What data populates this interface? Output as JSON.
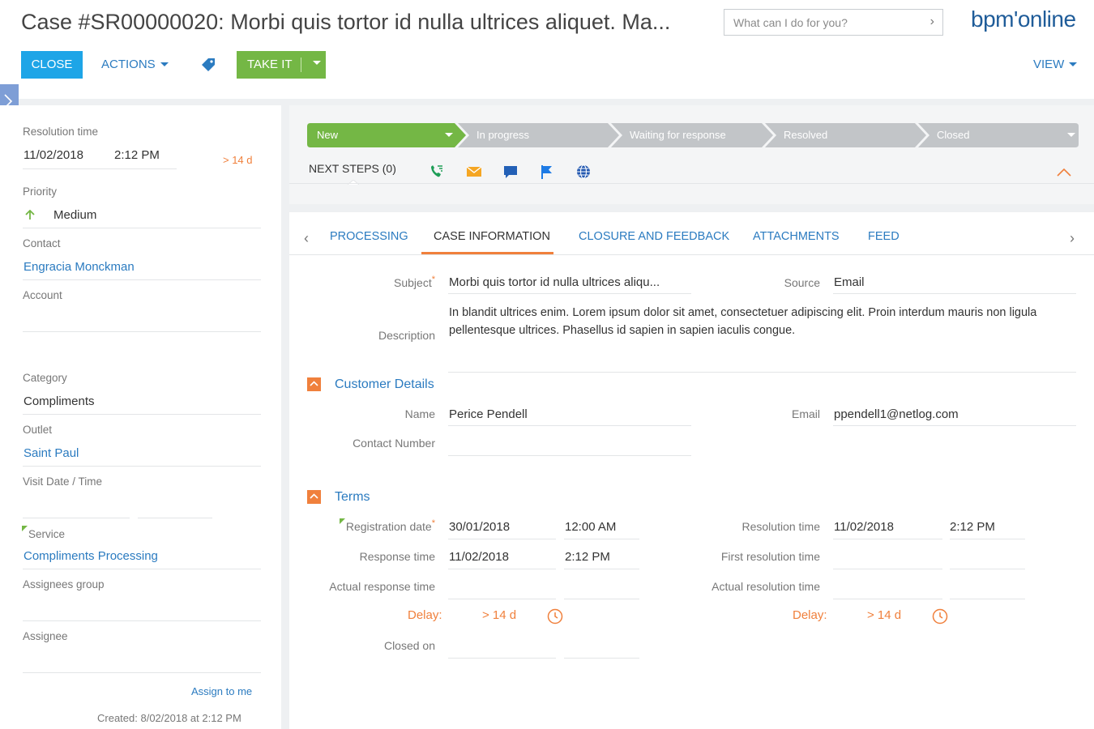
{
  "header": {
    "title": "Case #SR00000020: Morbi quis tortor id nulla ultrices aliquet. Ma...",
    "search_placeholder": "What can I do for you?",
    "brand": "bpm'online",
    "close_label": "CLOSE",
    "actions_label": "ACTIONS",
    "takeit_label": "TAKE IT",
    "view_label": "VIEW"
  },
  "left": {
    "resolution_time_label": "Resolution time",
    "resolution_date": "11/02/2018",
    "resolution_time": "2:12 PM",
    "resolution_overdue": "> 14 d",
    "priority_label": "Priority",
    "priority_value": "Medium",
    "contact_label": "Contact",
    "contact_value": "Engracia Monckman",
    "account_label": "Account",
    "category_label": "Category",
    "category_value": "Compliments",
    "outlet_label": "Outlet",
    "outlet_value": "Saint Paul",
    "visit_label": "Visit Date / Time",
    "service_label": "Service",
    "service_value": "Compliments Processing",
    "assignees_group_label": "Assignees group",
    "assignee_label": "Assignee",
    "assign_to_me": "Assign to me",
    "created": "Created: 8/02/2018 at 2:12 PM"
  },
  "stages": [
    {
      "label": "New",
      "active": true
    },
    {
      "label": "In progress",
      "active": false
    },
    {
      "label": "Waiting for response",
      "active": false
    },
    {
      "label": "Resolved",
      "active": false
    },
    {
      "label": "Closed",
      "active": false
    }
  ],
  "next_steps": "NEXT STEPS (0)",
  "next_step_icons": [
    "call-icon",
    "email-icon",
    "chat-icon",
    "flag-icon",
    "globe-icon"
  ],
  "tabs": [
    "PROCESSING",
    "CASE INFORMATION",
    "CLOSURE AND FEEDBACK",
    "ATTACHMENTS",
    "FEED"
  ],
  "active_tab": "CASE INFORMATION",
  "case_info": {
    "subject_label": "Subject",
    "subject_value": "Morbi quis tortor id nulla ultrices aliqu...",
    "source_label": "Source",
    "source_value": "Email",
    "description_label": "Description",
    "description_value": "In blandit ultrices enim. Lorem ipsum dolor sit amet, consectetuer adipiscing elit. Proin interdum mauris non ligula pellentesque ultrices. Phasellus id sapien in sapien iaculis congue."
  },
  "customer": {
    "section_title": "Customer Details",
    "name_label": "Name",
    "name_value": "Perice Pendell",
    "email_label": "Email",
    "email_value": "ppendell1@netlog.com",
    "contact_number_label": "Contact Number"
  },
  "terms": {
    "section_title": "Terms",
    "registration_label": "Registration date",
    "registration_date": "30/01/2018",
    "registration_time": "12:00 AM",
    "response_label": "Response time",
    "response_date": "11/02/2018",
    "response_time": "2:12 PM",
    "actual_response_label": "Actual response time",
    "resolution_label": "Resolution time",
    "resolution_date": "11/02/2018",
    "resolution_time": "2:12 PM",
    "first_resolution_label": "First resolution time",
    "actual_resolution_label": "Actual resolution time",
    "delay_label": "Delay:",
    "delay_value": "> 14 d",
    "closed_on_label": "Closed on"
  },
  "colors": {
    "accent_blue": "#1ea5e7",
    "link_blue": "#2b7bc0",
    "green": "#74b745",
    "orange": "#f0803c",
    "stage_gray": "#c2c5c8"
  }
}
